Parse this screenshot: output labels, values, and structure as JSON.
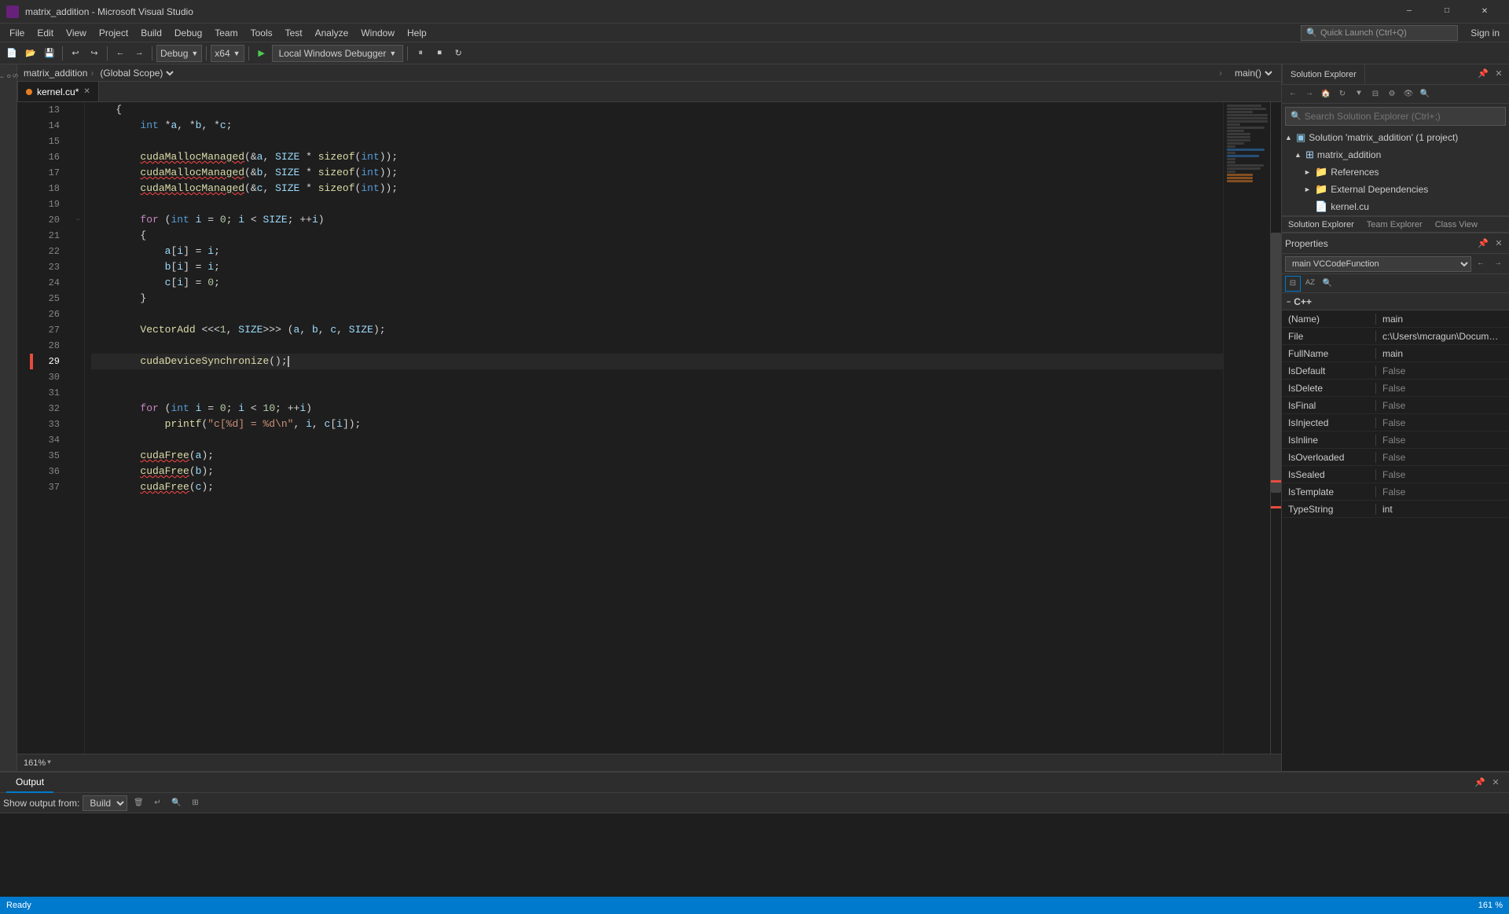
{
  "app": {
    "title": "matrix_addition - Microsoft Visual Studio",
    "icon": "vs-icon"
  },
  "titlebar": {
    "title": "matrix_addition - Microsoft Visual Studio",
    "min_label": "—",
    "max_label": "□",
    "close_label": "✕"
  },
  "menubar": {
    "items": [
      "File",
      "Edit",
      "View",
      "Project",
      "Build",
      "Debug",
      "Team",
      "Tools",
      "Test",
      "Analyze",
      "Window",
      "Help"
    ]
  },
  "toolbar": {
    "config": "Debug",
    "platform": "x64",
    "run_label": "Local Windows Debugger",
    "sign_in": "Sign in"
  },
  "tabs": [
    {
      "label": "kernel.cu",
      "active": true,
      "modified": true
    }
  ],
  "scope_bar": {
    "file": "matrix_addition",
    "scope": "(Global Scope)",
    "function": "main()"
  },
  "code": {
    "lines": [
      {
        "num": 13,
        "content": "    {",
        "indent": 1
      },
      {
        "num": 14,
        "content": "        int *a, *b, *c;",
        "indent": 2
      },
      {
        "num": 15,
        "content": "",
        "indent": 0
      },
      {
        "num": 16,
        "content": "        cudaMallocManaged(&a, SIZE * sizeof(int));",
        "indent": 2,
        "squiggle": true
      },
      {
        "num": 17,
        "content": "        cudaMallocManaged(&b, SIZE * sizeof(int));",
        "indent": 2,
        "squiggle": true
      },
      {
        "num": 18,
        "content": "        cudaMallocManaged(&c, SIZE * sizeof(int));",
        "indent": 2,
        "squiggle": true
      },
      {
        "num": 19,
        "content": "",
        "indent": 0
      },
      {
        "num": 20,
        "content": "        for (int i = 0; i < SIZE; ++i)",
        "indent": 2,
        "collapsible": true
      },
      {
        "num": 21,
        "content": "        {",
        "indent": 2
      },
      {
        "num": 22,
        "content": "            a[i] = i;",
        "indent": 3
      },
      {
        "num": 23,
        "content": "            b[i] = i;",
        "indent": 3
      },
      {
        "num": 24,
        "content": "            c[i] = 0;",
        "indent": 3
      },
      {
        "num": 25,
        "content": "        }",
        "indent": 2
      },
      {
        "num": 26,
        "content": "",
        "indent": 0
      },
      {
        "num": 27,
        "content": "        VectorAdd <<<1, SIZE>>> (a, b, c, SIZE);",
        "indent": 2
      },
      {
        "num": 28,
        "content": "",
        "indent": 0
      },
      {
        "num": 29,
        "content": "        cudaDeviceSynchronize();",
        "indent": 2,
        "cursor": true
      },
      {
        "num": 30,
        "content": "",
        "indent": 0
      },
      {
        "num": 31,
        "content": "",
        "indent": 0
      },
      {
        "num": 32,
        "content": "        for (int i = 0; i < 10; ++i)",
        "indent": 2
      },
      {
        "num": 33,
        "content": "            printf(\"c[%d] = %d\\n\", i, c[i]);",
        "indent": 3
      },
      {
        "num": 34,
        "content": "",
        "indent": 0
      },
      {
        "num": 35,
        "content": "        cudaFree(a);",
        "indent": 2,
        "squiggle": true
      },
      {
        "num": 36,
        "content": "        cudaFree(b);",
        "indent": 2,
        "squiggle": true
      },
      {
        "num": 37,
        "content": "        cudaFree(c);",
        "indent": 2,
        "squiggle": true
      }
    ]
  },
  "zoom": "161%",
  "solution_explorer": {
    "title": "Solution Explorer",
    "search_placeholder": "Search Solution Explorer (Ctrl+;)",
    "tree": [
      {
        "label": "Solution 'matrix_addition' (1 project)",
        "level": 0,
        "type": "solution",
        "expanded": true,
        "icon": "📋"
      },
      {
        "label": "matrix_addition",
        "level": 1,
        "type": "project",
        "expanded": true,
        "icon": "⊞"
      },
      {
        "label": "References",
        "level": 2,
        "type": "folder",
        "expanded": false,
        "icon": "📁"
      },
      {
        "label": "External Dependencies",
        "level": 2,
        "type": "folder",
        "expanded": false,
        "icon": "📁"
      },
      {
        "label": "kernel.cu",
        "level": 2,
        "type": "file",
        "icon": "📄"
      }
    ]
  },
  "properties": {
    "title": "Properties",
    "tabs": [
      "Solution Explorer",
      "Team Explorer",
      "Class View"
    ],
    "active_tab": "Solution Explorer",
    "function_selector": "main VCCodeFunction",
    "section_name": "C++",
    "rows": [
      {
        "key": "(Name)",
        "value": "main"
      },
      {
        "key": "File",
        "value": "c:\\Users\\mcragun\\Documents\\"
      },
      {
        "key": "FullName",
        "value": "main"
      },
      {
        "key": "IsDefault",
        "value": "False"
      },
      {
        "key": "IsDelete",
        "value": "False"
      },
      {
        "key": "IsFinal",
        "value": "False"
      },
      {
        "key": "IsInjected",
        "value": "False"
      },
      {
        "key": "IsInline",
        "value": "False"
      },
      {
        "key": "IsOverloaded",
        "value": "False"
      },
      {
        "key": "IsSealed",
        "value": "False"
      },
      {
        "key": "IsTemplate",
        "value": "False"
      },
      {
        "key": "TypeString",
        "value": "int"
      }
    ]
  },
  "output_panel": {
    "title": "Output",
    "show_output_from_label": "Show output from:",
    "source": "Build",
    "content": ""
  },
  "status_bar": {
    "zoom": "161 %",
    "caret_icon": "⟶"
  }
}
